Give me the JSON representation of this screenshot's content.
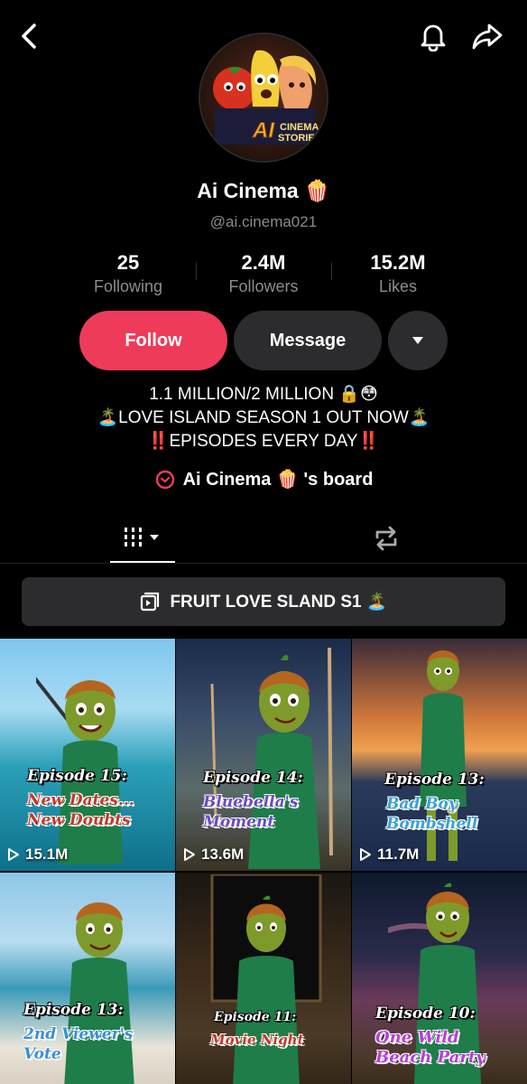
{
  "profile": {
    "name": "Ai Cinema 🍿",
    "handle": "@ai.cinema021",
    "avatar_text": [
      "AI",
      "CINEMA",
      "STORIES"
    ]
  },
  "stats": [
    {
      "value": "25",
      "label": "Following"
    },
    {
      "value": "2.4M",
      "label": "Followers"
    },
    {
      "value": "15.2M",
      "label": "Likes"
    }
  ],
  "actions": {
    "follow_label": "Follow",
    "message_label": "Message"
  },
  "bio": {
    "line1": "1.1 MILLION/2 MILLION 🔒😳",
    "line2": "🏝️LOVE ISLAND SEASON 1 OUT NOW🏝️",
    "line3": "‼️EPISODES EVERY DAY‼️"
  },
  "board": {
    "label": "Ai Cinema 🍿 's board"
  },
  "playlist": {
    "label": "FRUIT LOVE SLAND S1 🏝️"
  },
  "videos": [
    {
      "episode": "Episode 15:",
      "title_line1": "New Dates...",
      "title_line2": "New Doubts",
      "views": "15.1M",
      "title_color": "#c0392b"
    },
    {
      "episode": "Episode 14:",
      "title_line1": "Bluebella's",
      "title_line2": "Moment",
      "views": "13.6M",
      "title_color": "#6a4bc4"
    },
    {
      "episode": "Episode 13:",
      "title_line1": "Bad Boy",
      "title_line2": "Bombshell",
      "views": "11.7M",
      "title_color": "#3aa0d8"
    },
    {
      "episode": "Episode 13:",
      "title_line1": "2nd Viewer's",
      "title_line2": "Vote",
      "views": "",
      "title_color": "#3a8fd8"
    },
    {
      "episode": "Episode 11:",
      "title_line1": "Movie Night",
      "title_line2": "",
      "views": "",
      "title_color": "#c0392b"
    },
    {
      "episode": "Episode 10:",
      "title_line1": "One Wild",
      "title_line2": "Beach Party",
      "views": "",
      "title_color": "#b63fd6"
    }
  ],
  "colors": {
    "follow": "#ee3b5a",
    "button_dark": "#2c2c2e",
    "muted_text": "#8c8c8c"
  },
  "icons": [
    "back-icon",
    "bell-icon",
    "share-icon",
    "chevron-down-icon",
    "grid-icon",
    "repost-icon",
    "playlist-icon",
    "play-icon"
  ]
}
